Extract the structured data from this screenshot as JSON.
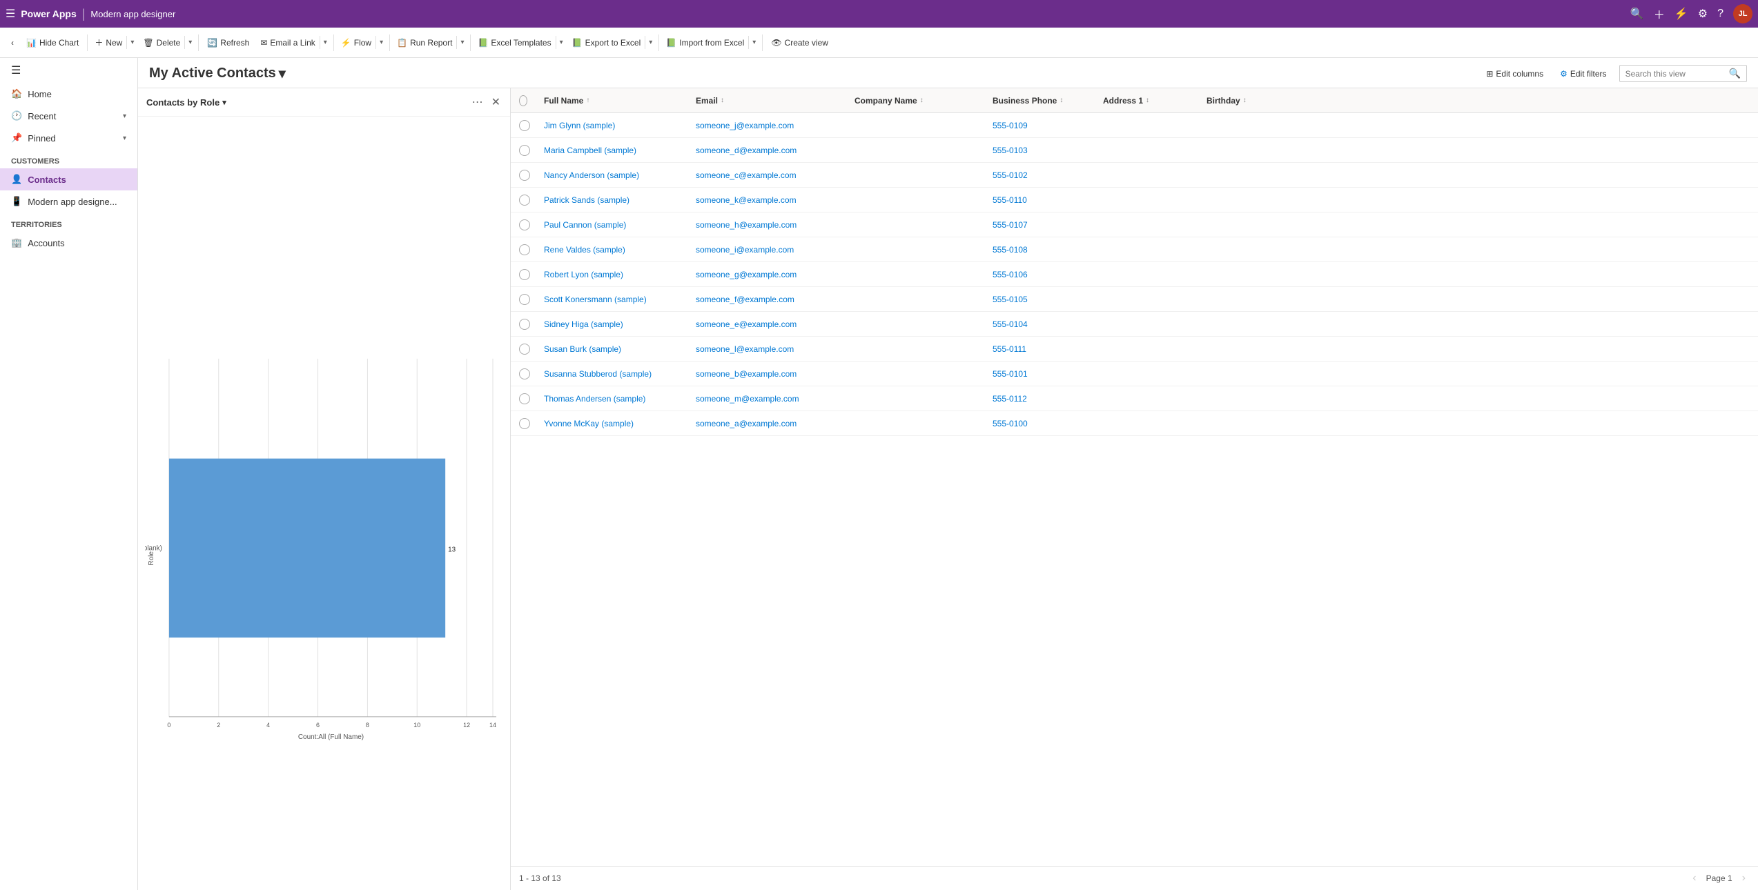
{
  "app": {
    "name": "Power Apps",
    "page_title": "Modern app designer"
  },
  "toolbar": {
    "hide_chart": "Hide Chart",
    "new": "New",
    "delete": "Delete",
    "refresh": "Refresh",
    "email_a_link": "Email a Link",
    "flow": "Flow",
    "run_report": "Run Report",
    "excel_templates": "Excel Templates",
    "export_to_excel": "Export to Excel",
    "import_from_excel": "Import from Excel",
    "create_view": "Create view"
  },
  "sidebar": {
    "items": [
      {
        "id": "home",
        "label": "Home",
        "icon": "🏠"
      },
      {
        "id": "recent",
        "label": "Recent",
        "icon": "🕐",
        "expandable": true
      },
      {
        "id": "pinned",
        "label": "Pinned",
        "icon": "📌",
        "expandable": true
      }
    ],
    "sections": [
      {
        "title": "Customers",
        "items": [
          {
            "id": "contacts",
            "label": "Contacts",
            "icon": "👤",
            "active": true
          },
          {
            "id": "modern_app",
            "label": "Modern app designe...",
            "icon": "📱"
          }
        ]
      },
      {
        "title": "Territories",
        "items": [
          {
            "id": "accounts",
            "label": "Accounts",
            "icon": "🏢"
          }
        ]
      }
    ]
  },
  "view": {
    "title": "My Active Contacts",
    "edit_columns_label": "Edit columns",
    "edit_filters_label": "Edit filters",
    "search_placeholder": "Search this view"
  },
  "chart": {
    "title": "Contacts by Role",
    "blank_label": "(blank)",
    "role_label": "Role",
    "count_label": "Count:All (Full Name)",
    "x_axis_values": [
      "0",
      "2",
      "4",
      "6",
      "8",
      "10",
      "12",
      "14"
    ],
    "bar_count": 13,
    "bar_value_label": "13"
  },
  "grid": {
    "columns": [
      {
        "id": "full_name",
        "label": "Full Name",
        "sortable": true,
        "sorted": true
      },
      {
        "id": "email",
        "label": "Email",
        "sortable": true
      },
      {
        "id": "company_name",
        "label": "Company Name",
        "sortable": true
      },
      {
        "id": "business_phone",
        "label": "Business Phone",
        "sortable": true
      },
      {
        "id": "address_1",
        "label": "Address 1",
        "sortable": true
      },
      {
        "id": "birthday",
        "label": "Birthday",
        "sortable": true
      }
    ],
    "rows": [
      {
        "full_name": "Jim Glynn (sample)",
        "email": "someone_j@example.com",
        "company": "",
        "phone": "555-0109",
        "address": "",
        "birthday": ""
      },
      {
        "full_name": "Maria Campbell (sample)",
        "email": "someone_d@example.com",
        "company": "",
        "phone": "555-0103",
        "address": "",
        "birthday": ""
      },
      {
        "full_name": "Nancy Anderson (sample)",
        "email": "someone_c@example.com",
        "company": "",
        "phone": "555-0102",
        "address": "",
        "birthday": ""
      },
      {
        "full_name": "Patrick Sands (sample)",
        "email": "someone_k@example.com",
        "company": "",
        "phone": "555-0110",
        "address": "",
        "birthday": ""
      },
      {
        "full_name": "Paul Cannon (sample)",
        "email": "someone_h@example.com",
        "company": "",
        "phone": "555-0107",
        "address": "",
        "birthday": ""
      },
      {
        "full_name": "Rene Valdes (sample)",
        "email": "someone_i@example.com",
        "company": "",
        "phone": "555-0108",
        "address": "",
        "birthday": ""
      },
      {
        "full_name": "Robert Lyon (sample)",
        "email": "someone_g@example.com",
        "company": "",
        "phone": "555-0106",
        "address": "",
        "birthday": ""
      },
      {
        "full_name": "Scott Konersmann (sample)",
        "email": "someone_f@example.com",
        "company": "",
        "phone": "555-0105",
        "address": "",
        "birthday": ""
      },
      {
        "full_name": "Sidney Higa (sample)",
        "email": "someone_e@example.com",
        "company": "",
        "phone": "555-0104",
        "address": "",
        "birthday": ""
      },
      {
        "full_name": "Susan Burk (sample)",
        "email": "someone_l@example.com",
        "company": "",
        "phone": "555-0111",
        "address": "",
        "birthday": ""
      },
      {
        "full_name": "Susanna Stubberod (sample)",
        "email": "someone_b@example.com",
        "company": "",
        "phone": "555-0101",
        "address": "",
        "birthday": ""
      },
      {
        "full_name": "Thomas Andersen (sample)",
        "email": "someone_m@example.com",
        "company": "",
        "phone": "555-0112",
        "address": "",
        "birthday": ""
      },
      {
        "full_name": "Yvonne McKay (sample)",
        "email": "someone_a@example.com",
        "company": "",
        "phone": "555-0100",
        "address": "",
        "birthday": ""
      }
    ],
    "footer": {
      "range": "1 - 13 of 13",
      "page": "Page 1"
    }
  }
}
